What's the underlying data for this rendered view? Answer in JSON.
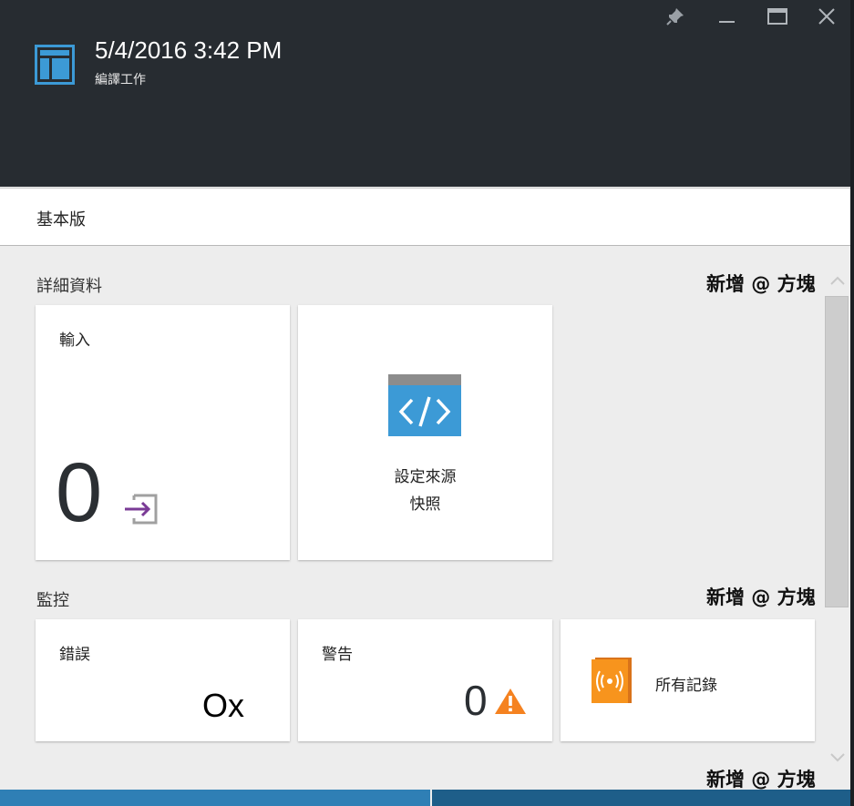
{
  "header": {
    "title": "5/4/2016 3:42 PM",
    "subtitle": "編譯工作",
    "icon": "blade-icon",
    "window_controls": [
      "pin-icon",
      "minimize-icon",
      "maximize-icon",
      "close-icon"
    ]
  },
  "command_bar": {
    "items": [
      "基本版"
    ]
  },
  "sections": {
    "details": {
      "title": "詳細資料",
      "add_tile": "新增 @ 方塊",
      "inputs_tile": {
        "label": "輸入",
        "count": "0",
        "icon": "input-arrow-icon"
      },
      "source_tile": {
        "line1": "設定來源",
        "line2": "快照",
        "icon": "code-icon"
      }
    },
    "monitoring": {
      "title": "監控",
      "add_tile": "新增 @ 方塊",
      "errors_tile": {
        "label": "錯誤",
        "value": "Ox"
      },
      "warnings_tile": {
        "label": "警告",
        "value": "0",
        "icon": "warning-icon"
      },
      "logs_tile": {
        "label": "所有記錄",
        "icon": "log-book-icon"
      }
    },
    "bottom": {
      "add_tile": "新增 @ 方塊"
    }
  },
  "colors": {
    "header_bg": "#272c31",
    "accent_blue": "#3c9ad6",
    "input_purple": "#7a3b96",
    "warning_orange": "#f58220",
    "log_orange": "#f7941d"
  }
}
